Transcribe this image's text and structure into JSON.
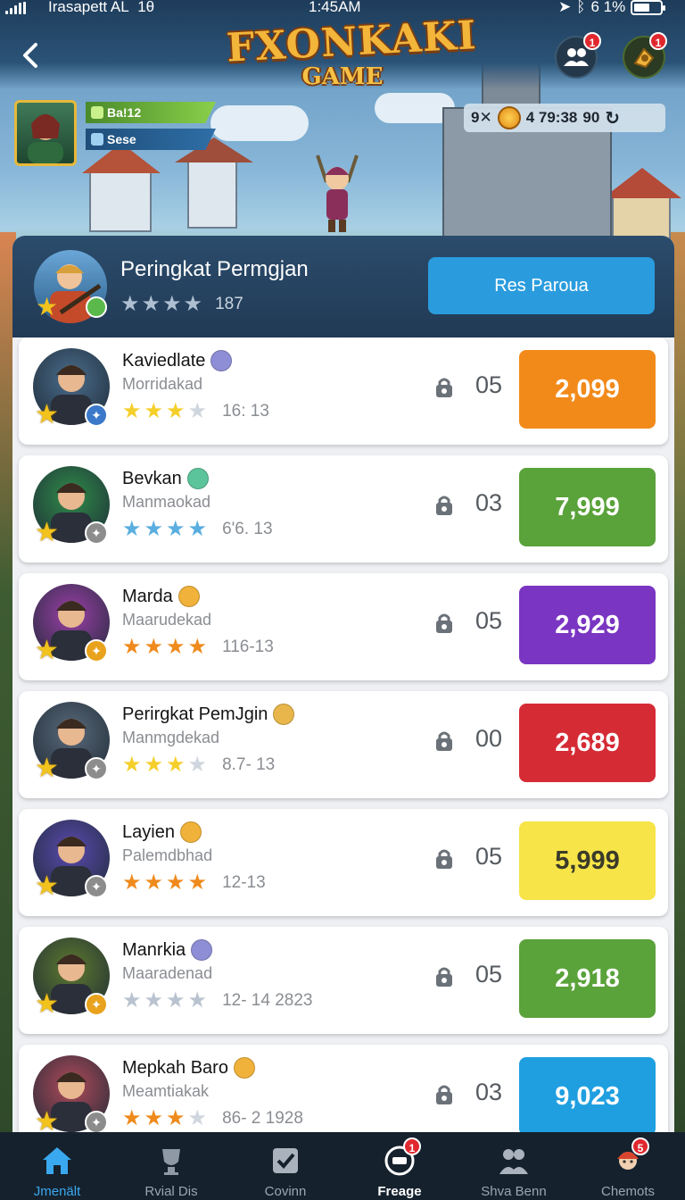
{
  "status_bar": {
    "carrier": "Irasapett AL",
    "carrier_extra": "1θ",
    "time": "1:45AM",
    "battery": "6 1%",
    "battery_level": 0.61
  },
  "header": {
    "logo_line1": "FXONKAKI",
    "logo_line2": "GAME",
    "friends_badge": "1",
    "gifts_badge": "1"
  },
  "profile": {
    "tag1": "Ba!12",
    "tag2": "Sese",
    "currency_left": "9✕",
    "currency_value": "4 79:38",
    "currency_right": "90"
  },
  "leaderboard": {
    "title": "Peringkat Permgjan",
    "rating": "187",
    "reset_label": "Res Paroua",
    "players": [
      {
        "name": "Kaviedlate",
        "sub": "Morridakad",
        "meta": "16: 13",
        "count": "05",
        "score": "2,099",
        "score_color": "#f28a1a",
        "score_text": "#ffffff",
        "stars_on": 3,
        "star_color": "#f5cf2a",
        "emblem": "#8e8ed6",
        "role": "#3a78c9",
        "avatar_bg": "#4a6d8c"
      },
      {
        "name": "Bevkan",
        "sub": "Manmaokad",
        "meta": "6'6. 13",
        "count": "03",
        "score": "7,999",
        "score_color": "#5aa23a",
        "score_text": "#ffffff",
        "stars_on": 0,
        "star_color": "#5aaee0",
        "emblem": "#5cc49a",
        "role": "#8c8c8c",
        "avatar_bg": "#2f8c4a"
      },
      {
        "name": "Marda",
        "sub": "Maarudekad",
        "meta": "116-13",
        "count": "05",
        "score": "2,929",
        "score_color": "#7a35c2",
        "score_text": "#ffffff",
        "stars_on": 4,
        "star_color": "#ef8a1c",
        "emblem": "#f0b23a",
        "role": "#e8a21c",
        "avatar_bg": "#9c3fa8"
      },
      {
        "name": "Perirgkat PemJgin",
        "sub": "Manmgdekad",
        "meta": "8.7- 13",
        "count": "00",
        "score": "2,689",
        "score_color": "#d52b35",
        "score_text": "#ffffff",
        "stars_on": 3,
        "star_color": "#f5cf2a",
        "emblem": "#e8b64a",
        "role": "#8c8c8c",
        "avatar_bg": "#5a6a7a"
      },
      {
        "name": "Layien",
        "sub": "Palemdbhad",
        "meta": "12-13",
        "count": "05",
        "score": "5,999",
        "score_color": "#f6e448",
        "score_text": "#3a3a2a",
        "stars_on": 4,
        "star_color": "#ef8a1c",
        "emblem": "#f0b23a",
        "role": "#8c8c8c",
        "avatar_bg": "#5a4ab0"
      },
      {
        "name": "Manrkia",
        "sub": "Maaradenad",
        "meta": "12- 14   2823",
        "count": "05",
        "score": "2,918",
        "score_color": "#5aa23a",
        "score_text": "#ffffff",
        "stars_on": 0,
        "star_color": "#b9c3d0",
        "emblem": "#8e8ed6",
        "role": "#e8a21c",
        "avatar_bg": "#5e7a2e"
      },
      {
        "name": "Mepkah Baro",
        "sub": "Meamtiakak",
        "meta": "86- 2   1928",
        "count": "03",
        "score": "9,023",
        "score_color": "#1f9fe0",
        "score_text": "#ffffff",
        "stars_on": 3,
        "star_color": "#ef8a1c",
        "emblem": "#f0b23a",
        "role": "#8c8c8c",
        "avatar_bg": "#b04a5a"
      }
    ]
  },
  "nav": {
    "items": [
      {
        "label": "Jmenält",
        "icon": "home-icon"
      },
      {
        "label": "Rvial Dis",
        "icon": "trophy-icon"
      },
      {
        "label": "Covinn",
        "icon": "checkbox-icon"
      },
      {
        "label": "Freage",
        "icon": "chat-icon",
        "badge": "1"
      },
      {
        "label": "Shva Benn",
        "icon": "people-icon"
      },
      {
        "label": "Chemots",
        "icon": "character-icon",
        "badge": "5"
      }
    ]
  },
  "colors": {
    "accent": "#2a9cde",
    "panel_header": "#213a55",
    "nav_bg": "#15212d",
    "nav_active": "#3aa8ee"
  }
}
